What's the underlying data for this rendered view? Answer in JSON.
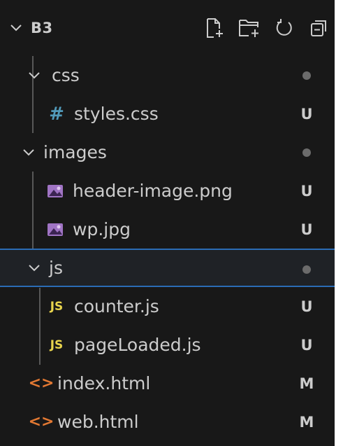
{
  "header": {
    "folder_name": "B3",
    "actions": [
      {
        "icon": "new-file-icon"
      },
      {
        "icon": "new-folder-icon"
      },
      {
        "icon": "refresh-icon"
      },
      {
        "icon": "collapse-all-icon"
      }
    ]
  },
  "tree": {
    "css": {
      "label": "css"
    },
    "styles": {
      "label": "styles.css",
      "status": "U"
    },
    "images": {
      "label": "images"
    },
    "header_image": {
      "label": "header-image.png",
      "status": "U"
    },
    "wp": {
      "label": "wp.jpg",
      "status": "U"
    },
    "js": {
      "label": "js"
    },
    "counter": {
      "label": "counter.js",
      "status": "U"
    },
    "page_loaded": {
      "label": "pageLoaded.js",
      "status": "U"
    },
    "index": {
      "label": "index.html",
      "status": "M"
    },
    "web": {
      "label": "web.html",
      "status": "M"
    }
  },
  "icons": {
    "css_file": "#",
    "js_file": "JS",
    "html_file": "<>"
  },
  "colors": {
    "background": "#181818",
    "text": "#cccccc",
    "selection_border": "#2b6cb5",
    "css_icon": "#519aba",
    "js_icon": "#e8d44d",
    "html_icon": "#e37933",
    "image_icon": "#a074c4"
  }
}
